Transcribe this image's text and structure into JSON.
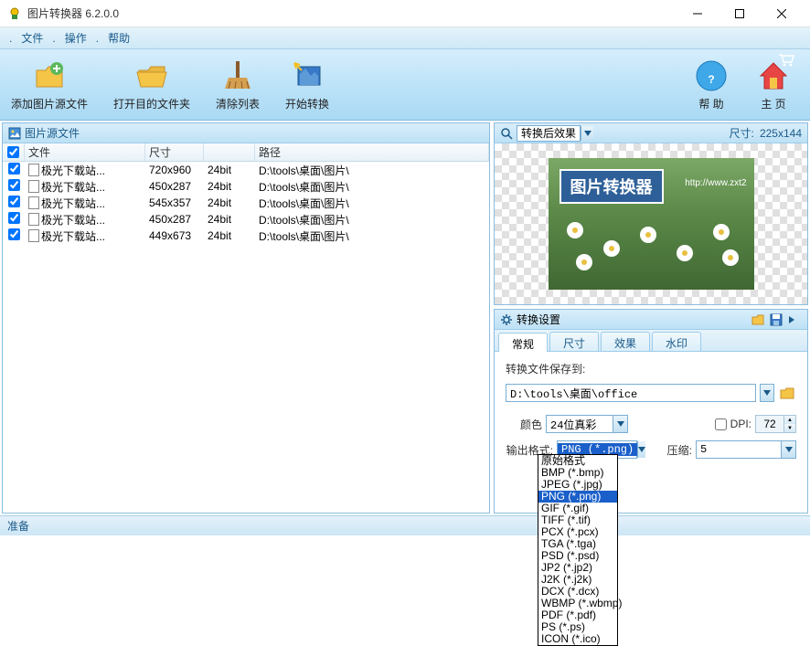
{
  "window": {
    "title": "图片转换器 6.2.0.0"
  },
  "menu": {
    "file": "文件",
    "operate": "操作",
    "help": "帮助"
  },
  "toolbar": {
    "add_source": "添加图片源文件",
    "open_dest": "打开目的文件夹",
    "clear_list": "清除列表",
    "start_convert": "开始转换",
    "help": "帮 助",
    "home": "主 页"
  },
  "left_panel": {
    "title": "图片源文件",
    "columns": {
      "file": "文件",
      "size": "尺寸",
      "path": "路径"
    },
    "rows": [
      {
        "checked": true,
        "file": "极光下载站...",
        "size": "720x960",
        "bit": "24bit",
        "path": "D:\\tools\\桌面\\图片\\"
      },
      {
        "checked": true,
        "file": "极光下载站...",
        "size": "450x287",
        "bit": "24bit",
        "path": "D:\\tools\\桌面\\图片\\"
      },
      {
        "checked": true,
        "file": "极光下载站...",
        "size": "545x357",
        "bit": "24bit",
        "path": "D:\\tools\\桌面\\图片\\"
      },
      {
        "checked": true,
        "file": "极光下载站...",
        "size": "450x287",
        "bit": "24bit",
        "path": "D:\\tools\\桌面\\图片\\"
      },
      {
        "checked": true,
        "file": "极光下载站...",
        "size": "449x673",
        "bit": "24bit",
        "path": "D:\\tools\\桌面\\图片\\"
      }
    ]
  },
  "preview": {
    "title": "转换后效果",
    "dim_label": "尺寸:",
    "dim_value": "225x144",
    "banner_text": "图片转换器",
    "banner_url": "http://www.zxt2"
  },
  "settings": {
    "title": "转换设置",
    "tabs": {
      "general": "常规",
      "size": "尺寸",
      "effect": "效果",
      "watermark": "水印"
    },
    "save_to_label": "转换文件保存到:",
    "save_to_value": "D:\\tools\\桌面\\office",
    "color_label": "颜色",
    "color_value": "24位真彩",
    "dpi_label": "DPI:",
    "dpi_value": "72",
    "format_label": "输出格式:",
    "format_value": "PNG (*.png)",
    "compress_label": "压缩:",
    "compress_value": "5",
    "format_options": [
      "原始格式",
      "BMP (*.bmp)",
      "JPEG (*.jpg)",
      "PNG (*.png)",
      "GIF (*.gif)",
      "TIFF (*.tif)",
      "PCX (*.pcx)",
      "TGA (*.tga)",
      "PSD (*.psd)",
      "JP2 (*.jp2)",
      "J2K (*.j2k)",
      "DCX (*.dcx)",
      "WBMP (*.wbmp)",
      "PDF (*.pdf)",
      "PS (*.ps)",
      "ICON (*.ico)"
    ],
    "format_selected_index": 3
  },
  "statusbar": {
    "text": "准备"
  }
}
